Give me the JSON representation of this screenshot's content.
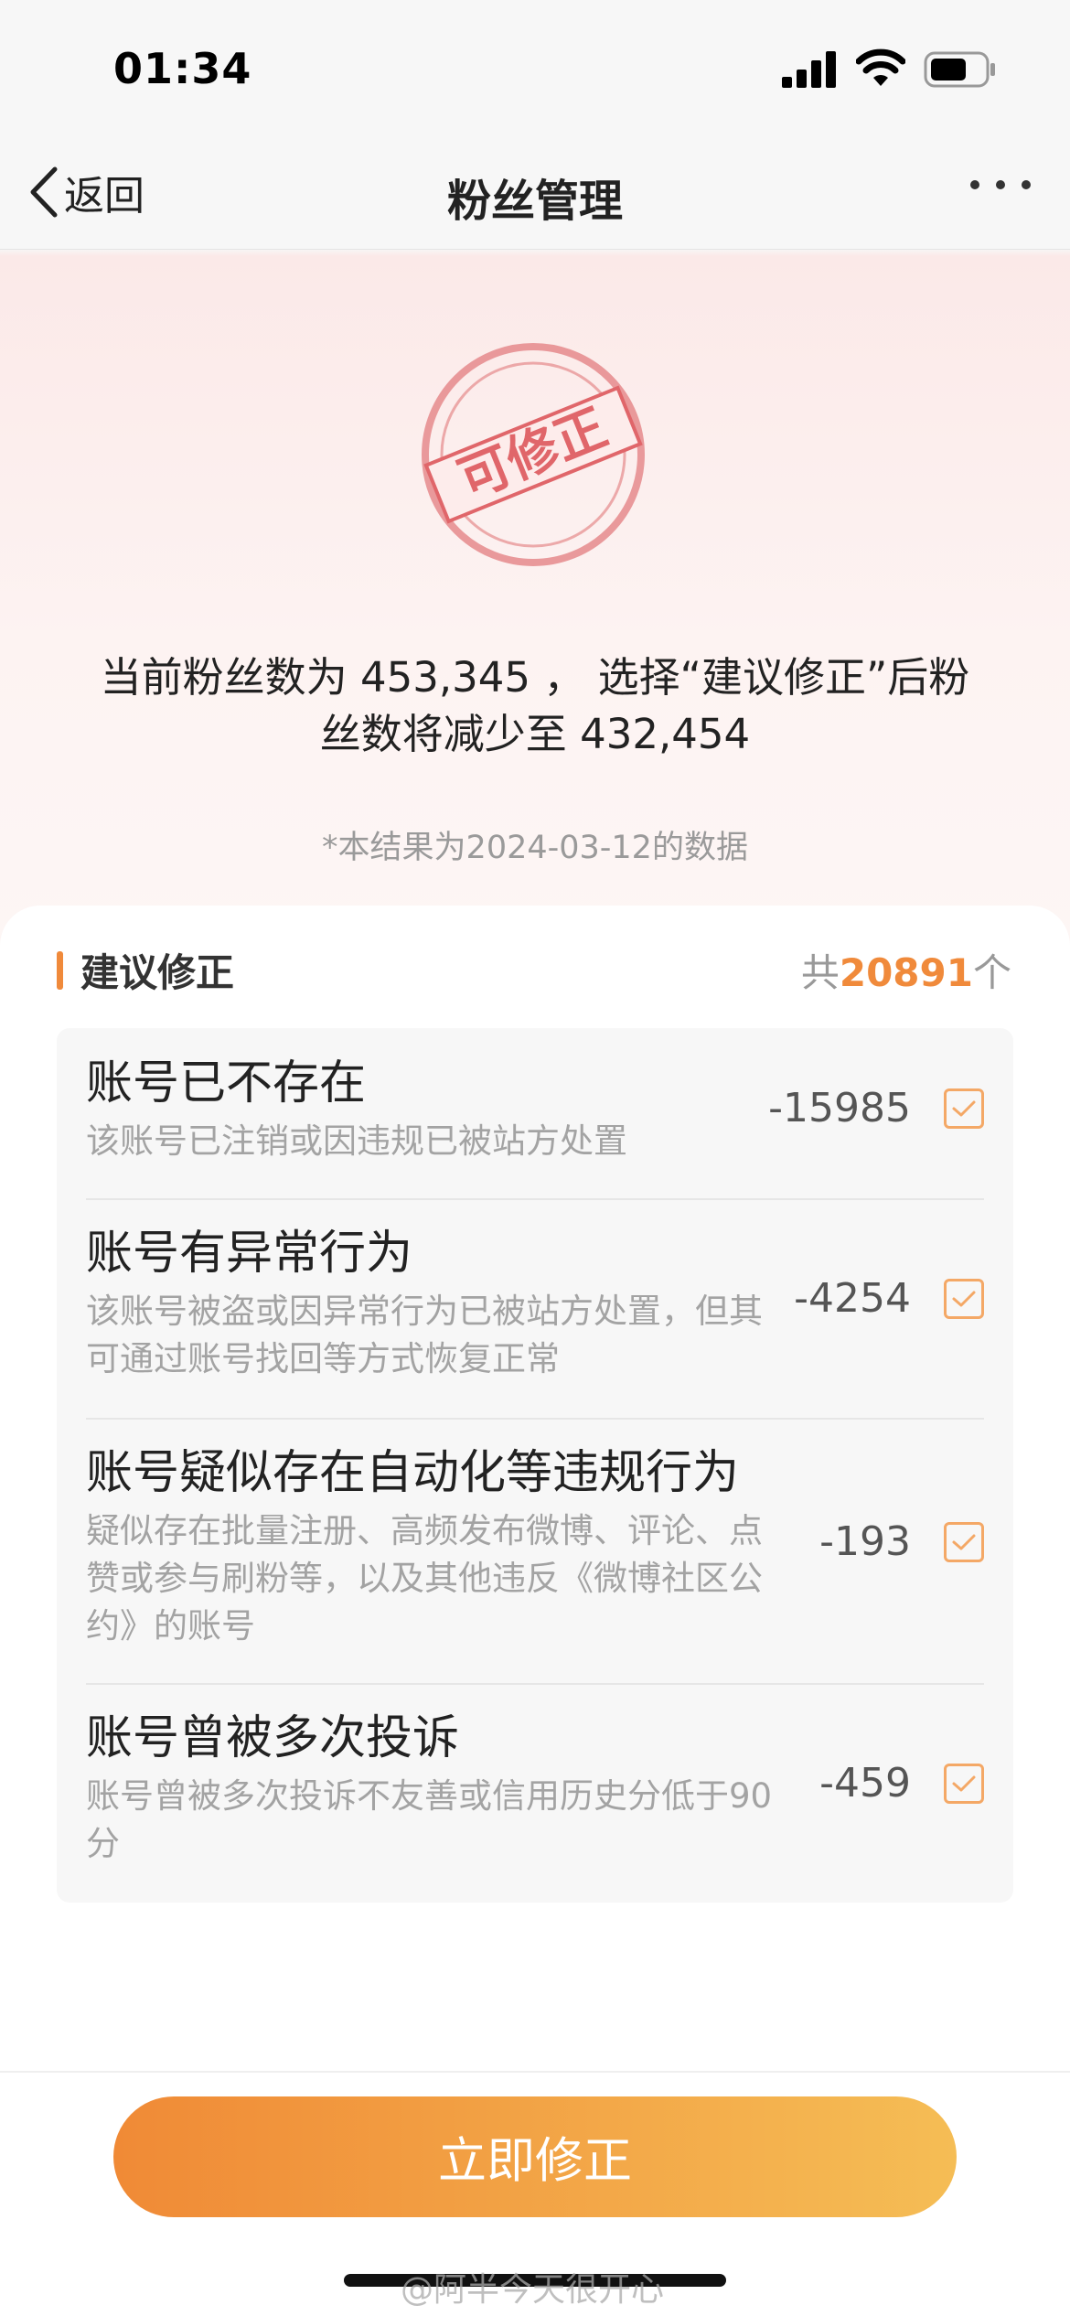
{
  "status_bar": {
    "time": "01:34"
  },
  "nav": {
    "back_label": "返回",
    "title": "粉丝管理"
  },
  "stamp": {
    "text": "可修正"
  },
  "summary": {
    "line1": "当前粉丝数为 453,345 ， 选择“建议修正”后粉",
    "line2": "丝数将减少至 432,454"
  },
  "note": "*本结果为2024-03-12的数据",
  "section": {
    "title": "建议修正",
    "total_prefix": "共",
    "total_count": "20891",
    "total_suffix": "个"
  },
  "items": [
    {
      "title": "账号已不存在",
      "desc": "该账号已注销或因违规已被站方处置",
      "count": "-15985",
      "checked": true
    },
    {
      "title": "账号有异常行为",
      "desc": "该账号被盗或因异常行为已被站方处置，但其可通过账号找回等方式恢复正常",
      "count": "-4254",
      "checked": true
    },
    {
      "title": "账号疑似存在自动化等违规行为",
      "desc": "疑似存在批量注册、高频发布微博、评论、点赞或参与刷粉等，以及其他违反《微博社区公约》的账号",
      "count": "-193",
      "checked": true
    },
    {
      "title": "账号曾被多次投诉",
      "desc": "账号曾被多次投诉不友善或信用历史分低于90分",
      "count": "-459",
      "checked": true
    }
  ],
  "cta": {
    "label": "立即修正"
  },
  "watermark": "@阿半今天很开心",
  "colors": {
    "accent": "#f08a3b",
    "stamp": "#e0666a",
    "cta_start": "#f08a36",
    "cta_end": "#f5bd55"
  }
}
